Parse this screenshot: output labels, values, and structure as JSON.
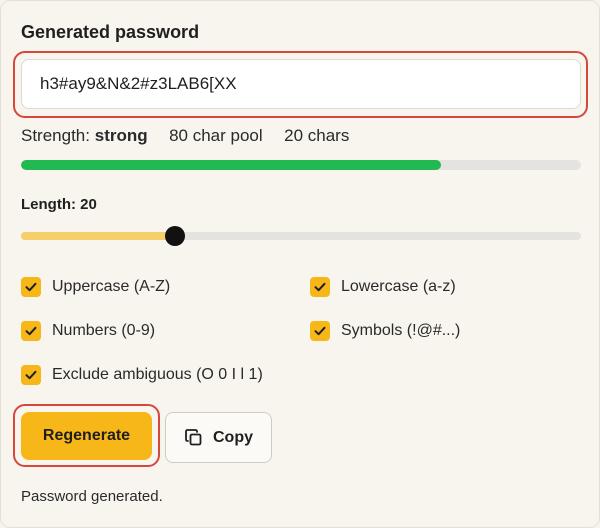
{
  "header": {
    "title": "Generated password"
  },
  "password": {
    "value": "h3#ay9&N&2#z3LAB6[XX"
  },
  "strength": {
    "label": "Strength:",
    "value": "strong",
    "pool": "80 char pool",
    "length_text": "20 chars",
    "bar_fraction": 0.75,
    "bar_color": "#22b852"
  },
  "length": {
    "label": "Length: 20",
    "slider_fraction": 0.275,
    "fill_color": "#f6cf6a"
  },
  "options": {
    "uppercase": {
      "label": "Uppercase (A-Z)",
      "checked": true
    },
    "lowercase": {
      "label": "Lowercase (a-z)",
      "checked": true
    },
    "numbers": {
      "label": "Numbers (0-9)",
      "checked": true
    },
    "symbols": {
      "label": "Symbols (!@#...)",
      "checked": true
    },
    "exclude_ambiguous": {
      "label": "Exclude ambiguous (O 0 I l 1)",
      "checked": true
    }
  },
  "actions": {
    "regenerate_label": "Regenerate",
    "copy_label": "Copy",
    "copy_icon": "copy-icon"
  },
  "status": {
    "message": "Password generated."
  },
  "colors": {
    "accent": "#f7b718",
    "highlight": "#d6483b"
  }
}
